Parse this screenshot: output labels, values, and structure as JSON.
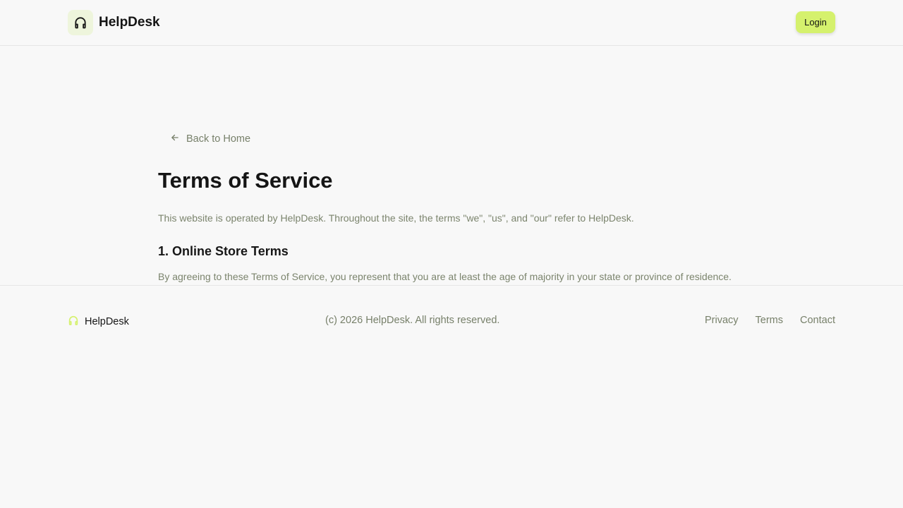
{
  "header": {
    "brand_name": "HelpDesk",
    "logo_icon": "headphones-icon",
    "login_label": "Login"
  },
  "main": {
    "back_label": "Back to Home",
    "back_icon": "arrow-left-icon",
    "title": "Terms of Service",
    "intro": "This website is operated by HelpDesk. Throughout the site, the terms \"we\", \"us\", and \"our\" refer to HelpDesk.",
    "section_heading": "1. Online Store Terms",
    "section_text": "By agreeing to these Terms of Service, you represent that you are at least the age of majority in your state or province of residence."
  },
  "footer": {
    "brand_name": "HelpDesk",
    "logo_icon": "headphones-icon",
    "copyright": "(c) 2026 HelpDesk. All rights reserved.",
    "links": [
      "Privacy",
      "Terms",
      "Contact"
    ]
  },
  "colors": {
    "background": "#f8f8f8",
    "accent": "#d5f16d",
    "logo_bg": "#eef5dc",
    "muted_text": "#7b846d",
    "text": "#151515"
  }
}
